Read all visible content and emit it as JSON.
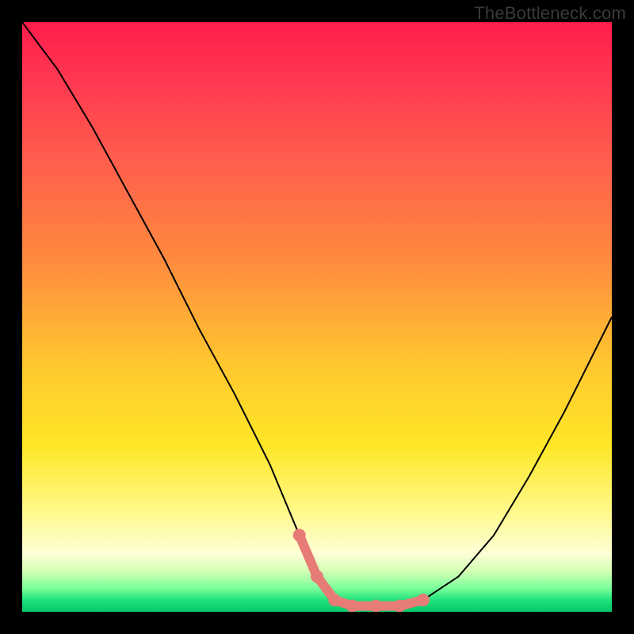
{
  "watermark": "TheBottleneck.com",
  "chart_data": {
    "type": "line",
    "title": "",
    "xlabel": "",
    "ylabel": "",
    "xlim": [
      0,
      100
    ],
    "ylim": [
      0,
      100
    ],
    "series": [
      {
        "name": "bottleneck-curve",
        "x": [
          0,
          6,
          12,
          18,
          24,
          30,
          36,
          42,
          47,
          50,
          53,
          56,
          60,
          64,
          68,
          74,
          80,
          86,
          92,
          100
        ],
        "y": [
          100,
          92,
          82,
          71,
          60,
          48,
          37,
          25,
          13,
          6,
          2,
          1,
          1,
          1,
          2,
          6,
          13,
          23,
          34,
          50
        ]
      }
    ],
    "highlight": {
      "name": "optimal-range",
      "x": [
        47,
        50,
        53,
        56,
        60,
        64,
        68
      ],
      "y": [
        13,
        6,
        2,
        1,
        1,
        1,
        2
      ]
    },
    "gradient_stops": [
      {
        "pos": 0,
        "color": "#ff1c4b"
      },
      {
        "pos": 22,
        "color": "#ff5a4e"
      },
      {
        "pos": 58,
        "color": "#ffc72f"
      },
      {
        "pos": 83,
        "color": "#fff98a"
      },
      {
        "pos": 96,
        "color": "#7bff9b"
      },
      {
        "pos": 100,
        "color": "#00c86a"
      }
    ]
  }
}
